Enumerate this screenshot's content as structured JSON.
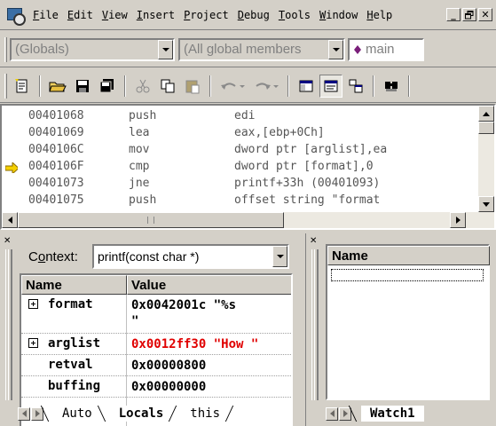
{
  "menubar": {
    "items": [
      {
        "label": "File",
        "u": "F",
        "rest": "ile"
      },
      {
        "label": "Edit",
        "u": "E",
        "rest": "dit"
      },
      {
        "label": "View",
        "u": "V",
        "rest": "iew"
      },
      {
        "label": "Insert",
        "u": "I",
        "rest": "nsert"
      },
      {
        "label": "Project",
        "u": "P",
        "rest": "roject"
      },
      {
        "label": "Debug",
        "u": "D",
        "rest": "ebug"
      },
      {
        "label": "Tools",
        "u": "T",
        "rest": "ools"
      },
      {
        "label": "Window",
        "u": "W",
        "rest": "indow"
      },
      {
        "label": "Help",
        "u": "H",
        "rest": "elp"
      }
    ],
    "window_buttons": {
      "minimize": "_",
      "restore": "🗗",
      "close": "✕"
    }
  },
  "wizardbar": {
    "scope": "(Globals)",
    "members": "(All global members",
    "function": "main",
    "function_icon": "purple-diamond-icon"
  },
  "toolbar": {
    "icons": [
      "new-text-file-icon",
      "open-folder-icon",
      "save-icon",
      "save-all-icon",
      "cut-icon",
      "copy-icon",
      "paste-icon",
      "undo-icon",
      "redo-icon",
      "workspace-icon",
      "output-icon",
      "window-list-icon",
      "find-in-files-icon"
    ]
  },
  "disassembly": {
    "rows": [
      {
        "addr": "00401068",
        "op": "push",
        "args": "edi",
        "current": false
      },
      {
        "addr": "00401069",
        "op": "lea",
        "args": "eax,[ebp+0Ch]",
        "current": false
      },
      {
        "addr": "0040106C",
        "op": "mov",
        "args": "dword ptr [arglist],ea",
        "current": false
      },
      {
        "addr": "0040106F",
        "op": "cmp",
        "args": "dword ptr [format],0",
        "current": true
      },
      {
        "addr": "00401073",
        "op": "jne",
        "args": "printf+33h (00401093)",
        "current": false
      },
      {
        "addr": "00401075",
        "op": "push",
        "args": "offset string \"format",
        "current": false
      }
    ]
  },
  "variables": {
    "context_label": "Context:",
    "context_u": "o",
    "context_value": "printf(const char *)",
    "headers": {
      "name": "Name",
      "value": "Value"
    },
    "rows": [
      {
        "name": "format",
        "value": "0x0042001c \"%s\n\"",
        "expandable": true,
        "changed": false
      },
      {
        "name": "arglist",
        "value": "0x0012ff30 \"How \"",
        "expandable": true,
        "changed": true
      },
      {
        "name": "retval",
        "value": "0x00000800",
        "expandable": false,
        "changed": false
      },
      {
        "name": "buffing",
        "value": "0x00000000",
        "expandable": false,
        "changed": false
      }
    ],
    "tabs": [
      "Auto",
      "Locals",
      "this"
    ],
    "active_tab": "Locals"
  },
  "watch": {
    "header": "Name",
    "tab": "Watch1"
  },
  "colors": {
    "face": "#d4d0c8",
    "changed_value": "#e00000",
    "current_arrow": "#f5d000"
  }
}
